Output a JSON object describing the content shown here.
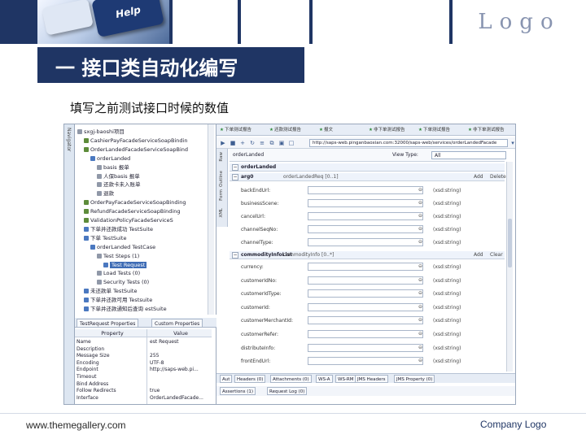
{
  "slide": {
    "logo": "Logo",
    "key_text": "Help",
    "title": "一 接口类自动化编写",
    "subtitle": "填写之前测试接口时候的数值",
    "footer_left": "www.themegallery.com",
    "footer_right": "Company Logo"
  },
  "screenshot": {
    "navigator_label": "Navigator",
    "tree": [
      {
        "label": "sxgj-baoshi项目",
        "indent": 0,
        "icon": "gray",
        "sel": false
      },
      {
        "label": "CashierPayFacadeServiceSoapBindin",
        "indent": 2,
        "icon": "green",
        "sel": false
      },
      {
        "label": "OrderLandedFacadeServiceSoapBind",
        "indent": 2,
        "icon": "green",
        "sel": false
      },
      {
        "label": "orderLanded",
        "indent": 4,
        "icon": "blue",
        "sel": false
      },
      {
        "label": "basis 报单",
        "indent": 6,
        "icon": "gray",
        "sel": false
      },
      {
        "label": "人保basis 报单",
        "indent": 6,
        "icon": "gray",
        "sel": false
      },
      {
        "label": "还款卡未入账单",
        "indent": 6,
        "icon": "gray",
        "sel": false
      },
      {
        "label": "退款",
        "indent": 6,
        "icon": "gray",
        "sel": false
      },
      {
        "label": "OrderPayFacadeServiceSoapBinding",
        "indent": 2,
        "icon": "green",
        "sel": false
      },
      {
        "label": "RefundFacadeServiceSoapBinding",
        "indent": 2,
        "icon": "green",
        "sel": false
      },
      {
        "label": "ValidationPolicyFacadeServiceS",
        "indent": 2,
        "icon": "green",
        "sel": false
      },
      {
        "label": "下单并还款成功 TestSuite",
        "indent": 2,
        "icon": "blue",
        "sel": false
      },
      {
        "label": "下单 TestSuite",
        "indent": 2,
        "icon": "blue",
        "sel": false
      },
      {
        "label": "orderLanded TestCase",
        "indent": 4,
        "icon": "blue",
        "sel": false
      },
      {
        "label": "Test Steps (1)",
        "indent": 6,
        "icon": "gray",
        "sel": false
      },
      {
        "label": "Test Request",
        "indent": 8,
        "icon": "blue",
        "sel": true
      },
      {
        "label": "Load Tests (0)",
        "indent": 6,
        "icon": "gray",
        "sel": false
      },
      {
        "label": "Security Tests (0)",
        "indent": 6,
        "icon": "gray",
        "sel": false
      },
      {
        "label": "未还款单 TestSuite",
        "indent": 2,
        "icon": "blue",
        "sel": false
      },
      {
        "label": "下单并还款可用 Testsuite",
        "indent": 2,
        "icon": "blue",
        "sel": false
      },
      {
        "label": "下单并还款通知后查询 estSuite",
        "indent": 2,
        "icon": "blue",
        "sel": false
      }
    ],
    "props_tabs": [
      "TestRequest Properties",
      "Custom Properties"
    ],
    "props_header": {
      "property": "Property",
      "value": "Value"
    },
    "props_rows": [
      {
        "name": "Name",
        "value": "est Request"
      },
      {
        "name": "Description",
        "value": ""
      },
      {
        "name": "Message Size",
        "value": "255"
      },
      {
        "name": "Encoding",
        "value": "UTF-8"
      },
      {
        "name": "Endpoint",
        "value": "http://saps-web.pi..."
      },
      {
        "name": "Timeout",
        "value": ""
      },
      {
        "name": "Bind Address",
        "value": ""
      },
      {
        "name": "Follow Redirects",
        "value": "true"
      },
      {
        "name": "Interface",
        "value": "OrderLandedFacade..."
      }
    ],
    "toolbar_tabs": [
      "下单测试报告",
      "还款测试报告",
      "报文",
      "非下单测试报告",
      "下单测试报告",
      "非下单测试报告"
    ],
    "url": "http://saps-web.pinganbaoxian.com:32000/saps-web/services/orderLandedFacade",
    "vertical_tabs": [
      "Raw",
      "Outline",
      "Form",
      "XML"
    ],
    "form_head_left": "orderLanded",
    "form_head_right_label": "View Type:",
    "form_head_select": "All",
    "sections": [
      {
        "name": "orderLanded",
        "type": "",
        "a": "",
        "b": ""
      },
      {
        "name": "arg0",
        "type": "orderLandedReq [0..1]",
        "a": "Add",
        "b": "Delete"
      },
      {
        "name": "commodityInfoList",
        "type": "commodityInfo [0..*]",
        "a": "Add",
        "b": "Clear"
      }
    ],
    "fields_a": [
      {
        "label": "backEndUrl:",
        "type": "(xsd:string)"
      },
      {
        "label": "businessScene:",
        "type": "(xsd:string)"
      },
      {
        "label": "cancelUrl:",
        "type": "(xsd:string)"
      },
      {
        "label": "channelSeqNo:",
        "type": "(xsd:string)"
      },
      {
        "label": "channelType:",
        "type": "(xsd:string)"
      }
    ],
    "fields_b": [
      {
        "label": "currency:",
        "type": "(xsd:string)"
      },
      {
        "label": "customerIdNo:",
        "type": "(xsd:string)"
      },
      {
        "label": "customerIdType:",
        "type": "(xsd:string)"
      },
      {
        "label": "customerId:",
        "type": "(xsd:string)"
      },
      {
        "label": "customerMerchantId:",
        "type": "(xsd:string)"
      },
      {
        "label": "customerRefer:",
        "type": "(xsd:string)"
      },
      {
        "label": "distributeInfo:",
        "type": "(xsd:string)"
      },
      {
        "label": "frontEndUrl:",
        "type": "(xsd:string)"
      }
    ],
    "bottom_tabs": [
      "Aut",
      "Headers (0)",
      "Attachments (0)",
      "WS-A",
      "WS-RM",
      "JMS Headers",
      "JMS Property (0)"
    ],
    "bottom_tabs2": [
      "Assertions (1)",
      "Request Log (0)"
    ]
  }
}
